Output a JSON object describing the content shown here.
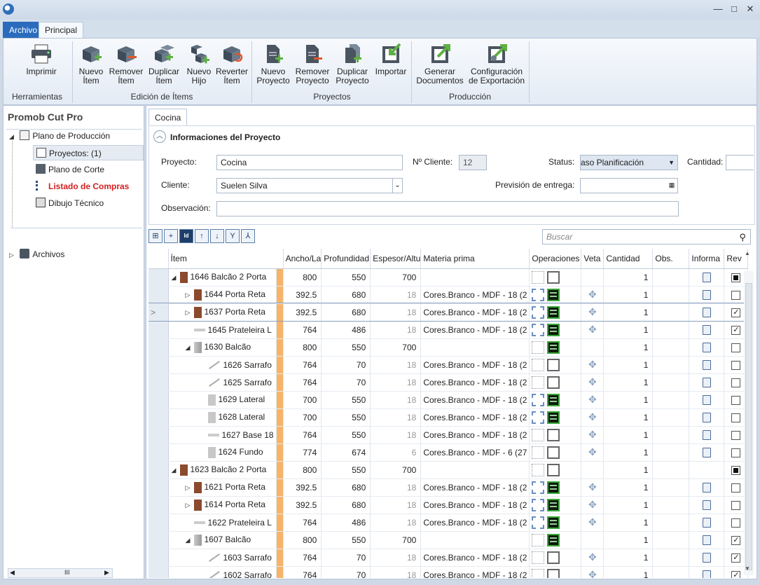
{
  "window": {
    "minimize": "—",
    "maximize": "□",
    "close": "✕"
  },
  "ribbon_tabs": {
    "archivo": "Archivo",
    "principal": "Principal"
  },
  "ribbon": {
    "herramientas": {
      "label": "Herramientas",
      "imprimir": "Imprimir"
    },
    "edicion": {
      "label": "Edición de Ítems",
      "nuevo_item": [
        "Nuevo",
        "Ítem"
      ],
      "remover_item": [
        "Remover",
        "Ítem"
      ],
      "duplicar_item": [
        "Duplicar",
        "Ítem"
      ],
      "nuevo_hijo": [
        "Nuevo",
        "Hijo"
      ],
      "reverter_item": [
        "Reverter",
        "Ítem"
      ]
    },
    "proyectos": {
      "label": "Proyectos",
      "nuevo_proyecto": [
        "Nuevo",
        "Proyecto"
      ],
      "remover_proyecto": [
        "Remover",
        "Proyecto"
      ],
      "duplicar_proyecto": [
        "Duplicar",
        "Proyecto"
      ],
      "importar": "Importar"
    },
    "produccion": {
      "label": "Producción",
      "generar": [
        "Generar",
        "Documentos"
      ],
      "config": [
        "Configuración",
        "de Exportación"
      ]
    }
  },
  "sidebar": {
    "title": "Promob Cut Pro",
    "root": "Plano de Producción",
    "items": [
      "Proyectos: (1)",
      "Plano de Corte",
      "Listado de Compras",
      "Dibujo Técnico"
    ],
    "archivos": "Archivos",
    "hscroll": "III"
  },
  "doc_tab": "Cocina",
  "info": {
    "header": "Informaciones del Proyecto",
    "proyecto_label": "Proyecto:",
    "proyecto": "Cocina",
    "cliente_num_label": "Nº Cliente:",
    "cliente_num": "12",
    "status_label": "Status:",
    "status": "aso Planificación",
    "cantidad_label": "Cantidad:",
    "cliente_label": "Cliente:",
    "cliente": "Suelen Silva",
    "prevision_label": "Previsión de entrega:",
    "observacion_label": "Observación:"
  },
  "search_placeholder": "Buscar",
  "toolbar_icons": [
    "expand-all-icon",
    "add-row-icon",
    "id-icon",
    "arrow-up-icon",
    "arrow-down-icon",
    "merge-icon",
    "split-icon"
  ],
  "columns": [
    "Ítem",
    "Ancho/La",
    "Profundidad",
    "Espesor/Altu",
    "Materia prima",
    "Operaciones",
    "Veta",
    "Cantidad",
    "Obs.",
    "Informa",
    "Rev"
  ],
  "rows": [
    {
      "level": 0,
      "exp": "◢",
      "piece": "door2",
      "item": "1646  Balcão 2 Porta",
      "ancho": "800",
      "prof": "550",
      "esp": "700",
      "esp_grey": false,
      "mat": "",
      "ops": [
        "A-light",
        "B"
      ],
      "veta": false,
      "cant": "1",
      "info": true,
      "rev": "tri"
    },
    {
      "level": 1,
      "exp": "▷",
      "piece": "door",
      "item": "1644  Porta Reta",
      "ancho": "392.5",
      "prof": "680",
      "esp": "18",
      "esp_grey": true,
      "mat": "Cores.Branco - MDF - 18 (2",
      "ops": [
        "A",
        "C"
      ],
      "veta": true,
      "cant": "1",
      "info": true,
      "rev": "off"
    },
    {
      "level": 1,
      "exp": "▷",
      "piece": "door",
      "item": "1637  Porta Reta",
      "ancho": "392.5",
      "prof": "680",
      "esp": "18",
      "esp_grey": true,
      "mat": "Cores.Branco - MDF - 18 (2",
      "ops": [
        "A",
        "C"
      ],
      "veta": true,
      "cant": "1",
      "info": true,
      "rev": "on",
      "current": true
    },
    {
      "level": 1,
      "exp": "",
      "piece": "flat",
      "item": "1645  Prateleira L",
      "ancho": "764",
      "prof": "486",
      "esp": "18",
      "esp_grey": true,
      "mat": "Cores.Branco - MDF - 18 (2",
      "ops": [
        "A",
        "C"
      ],
      "veta": true,
      "cant": "1",
      "info": true,
      "rev": "on"
    },
    {
      "level": 1,
      "exp": "◢",
      "piece": "cab",
      "item": "1630  Balcão",
      "ancho": "800",
      "prof": "550",
      "esp": "700",
      "esp_grey": false,
      "mat": "",
      "ops": [
        "A-light",
        "C"
      ],
      "veta": false,
      "cant": "1",
      "info": true,
      "rev": "off"
    },
    {
      "level": 2,
      "exp": "",
      "piece": "strip",
      "item": "1626  Sarrafo",
      "ancho": "764",
      "prof": "70",
      "esp": "18",
      "esp_grey": true,
      "mat": "Cores.Branco - MDF - 18 (2",
      "ops": [
        "A-light",
        "B"
      ],
      "veta": true,
      "cant": "1",
      "info": true,
      "rev": "off"
    },
    {
      "level": 2,
      "exp": "",
      "piece": "strip",
      "item": "1625  Sarrafo",
      "ancho": "764",
      "prof": "70",
      "esp": "18",
      "esp_grey": true,
      "mat": "Cores.Branco - MDF - 18 (2",
      "ops": [
        "A-light",
        "B"
      ],
      "veta": true,
      "cant": "1",
      "info": true,
      "rev": "off"
    },
    {
      "level": 2,
      "exp": "",
      "piece": "panel",
      "item": "1629  Lateral",
      "ancho": "700",
      "prof": "550",
      "esp": "18",
      "esp_grey": true,
      "mat": "Cores.Branco - MDF - 18 (2",
      "ops": [
        "A",
        "C"
      ],
      "veta": true,
      "cant": "1",
      "info": true,
      "rev": "off"
    },
    {
      "level": 2,
      "exp": "",
      "piece": "panel",
      "item": "1628  Lateral",
      "ancho": "700",
      "prof": "550",
      "esp": "18",
      "esp_grey": true,
      "mat": "Cores.Branco - MDF - 18 (2",
      "ops": [
        "A",
        "C"
      ],
      "veta": true,
      "cant": "1",
      "info": true,
      "rev": "off"
    },
    {
      "level": 2,
      "exp": "",
      "piece": "flat",
      "item": "1627  Base 18",
      "ancho": "764",
      "prof": "550",
      "esp": "18",
      "esp_grey": true,
      "mat": "Cores.Branco - MDF - 18 (2",
      "ops": [
        "A-light",
        "B"
      ],
      "veta": true,
      "cant": "1",
      "info": true,
      "rev": "off"
    },
    {
      "level": 2,
      "exp": "",
      "piece": "panel",
      "item": "1624  Fundo",
      "ancho": "774",
      "prof": "674",
      "esp": "6",
      "esp_grey": true,
      "mat": "Cores.Branco - MDF - 6 (27",
      "ops": [
        "A-light",
        "B"
      ],
      "veta": true,
      "cant": "1",
      "info": true,
      "rev": "off"
    },
    {
      "level": 0,
      "exp": "◢",
      "piece": "door2",
      "item": "1623  Balcão 2 Porta",
      "ancho": "800",
      "prof": "550",
      "esp": "700",
      "esp_grey": false,
      "mat": "",
      "ops": [
        "A-light",
        "B"
      ],
      "veta": false,
      "cant": "1",
      "info": false,
      "rev": "tri"
    },
    {
      "level": 1,
      "exp": "▷",
      "piece": "door",
      "item": "1621  Porta Reta",
      "ancho": "392.5",
      "prof": "680",
      "esp": "18",
      "esp_grey": true,
      "mat": "Cores.Branco - MDF - 18 (2",
      "ops": [
        "A",
        "C"
      ],
      "veta": true,
      "cant": "1",
      "info": true,
      "rev": "off"
    },
    {
      "level": 1,
      "exp": "▷",
      "piece": "door",
      "item": "1614  Porta Reta",
      "ancho": "392.5",
      "prof": "680",
      "esp": "18",
      "esp_grey": true,
      "mat": "Cores.Branco - MDF - 18 (2",
      "ops": [
        "A",
        "C"
      ],
      "veta": true,
      "cant": "1",
      "info": true,
      "rev": "off"
    },
    {
      "level": 1,
      "exp": "",
      "piece": "flat",
      "item": "1622  Prateleira L",
      "ancho": "764",
      "prof": "486",
      "esp": "18",
      "esp_grey": true,
      "mat": "Cores.Branco - MDF - 18 (2",
      "ops": [
        "A",
        "C"
      ],
      "veta": true,
      "cant": "1",
      "info": true,
      "rev": "off"
    },
    {
      "level": 1,
      "exp": "◢",
      "piece": "cab",
      "item": "1607  Balcão",
      "ancho": "800",
      "prof": "550",
      "esp": "700",
      "esp_grey": false,
      "mat": "",
      "ops": [
        "A-light",
        "C"
      ],
      "veta": false,
      "cant": "1",
      "info": true,
      "rev": "on"
    },
    {
      "level": 2,
      "exp": "",
      "piece": "strip",
      "item": "1603  Sarrafo",
      "ancho": "764",
      "prof": "70",
      "esp": "18",
      "esp_grey": true,
      "mat": "Cores.Branco - MDF - 18 (2",
      "ops": [
        "A-light",
        "B"
      ],
      "veta": true,
      "cant": "1",
      "info": true,
      "rev": "on"
    },
    {
      "level": 2,
      "exp": "",
      "piece": "strip",
      "item": "1602  Sarrafo",
      "ancho": "764",
      "prof": "70",
      "esp": "18",
      "esp_grey": true,
      "mat": "Cores.Branco - MDF - 18 (2",
      "ops": [
        "A-light",
        "B"
      ],
      "veta": true,
      "cant": "1",
      "info": true,
      "rev": "on"
    }
  ]
}
